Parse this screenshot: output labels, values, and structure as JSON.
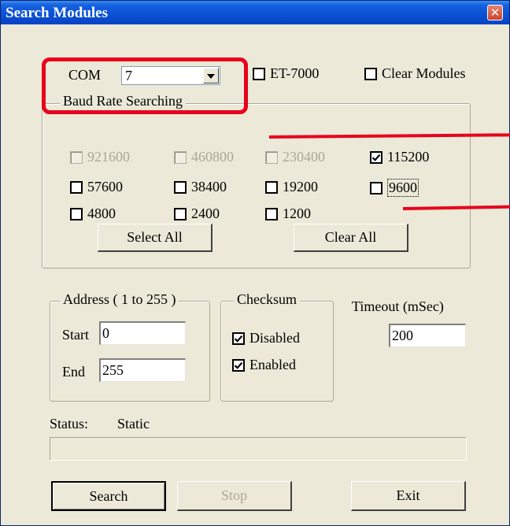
{
  "window": {
    "title": "Search Modules"
  },
  "com": {
    "label": "COM",
    "value": "7"
  },
  "options": {
    "et7000": {
      "label": "ET-7000",
      "checked": false
    },
    "clear_modules": {
      "label": "Clear Modules",
      "checked": false
    }
  },
  "baud": {
    "legend": "Baud Rate Searching",
    "rates": [
      {
        "label": "921600",
        "checked": false,
        "enabled": false
      },
      {
        "label": "460800",
        "checked": false,
        "enabled": false
      },
      {
        "label": "230400",
        "checked": false,
        "enabled": false
      },
      {
        "label": "115200",
        "checked": true,
        "enabled": true
      },
      {
        "label": "57600",
        "checked": false,
        "enabled": true
      },
      {
        "label": "38400",
        "checked": false,
        "enabled": true
      },
      {
        "label": "19200",
        "checked": false,
        "enabled": true
      },
      {
        "label": "9600",
        "checked": false,
        "enabled": true
      },
      {
        "label": "4800",
        "checked": false,
        "enabled": true
      },
      {
        "label": "2400",
        "checked": false,
        "enabled": true
      },
      {
        "label": "1200",
        "checked": false,
        "enabled": true
      }
    ],
    "select_all_label": "Select All",
    "clear_all_label": "Clear All"
  },
  "address": {
    "legend": "Address ( 1 to 255 )",
    "start_label": "Start",
    "start_value": "0",
    "end_label": "End",
    "end_value": "255"
  },
  "checksum": {
    "legend": "Checksum",
    "disabled": {
      "label": "Disabled",
      "checked": true
    },
    "enabled": {
      "label": "Enabled",
      "checked": true
    }
  },
  "timeout": {
    "label": "Timeout (mSec)",
    "value": "200"
  },
  "status": {
    "label": "Status:",
    "value": "Static",
    "progress": 0
  },
  "buttons": {
    "search": "Search",
    "stop": "Stop",
    "exit": "Exit"
  }
}
